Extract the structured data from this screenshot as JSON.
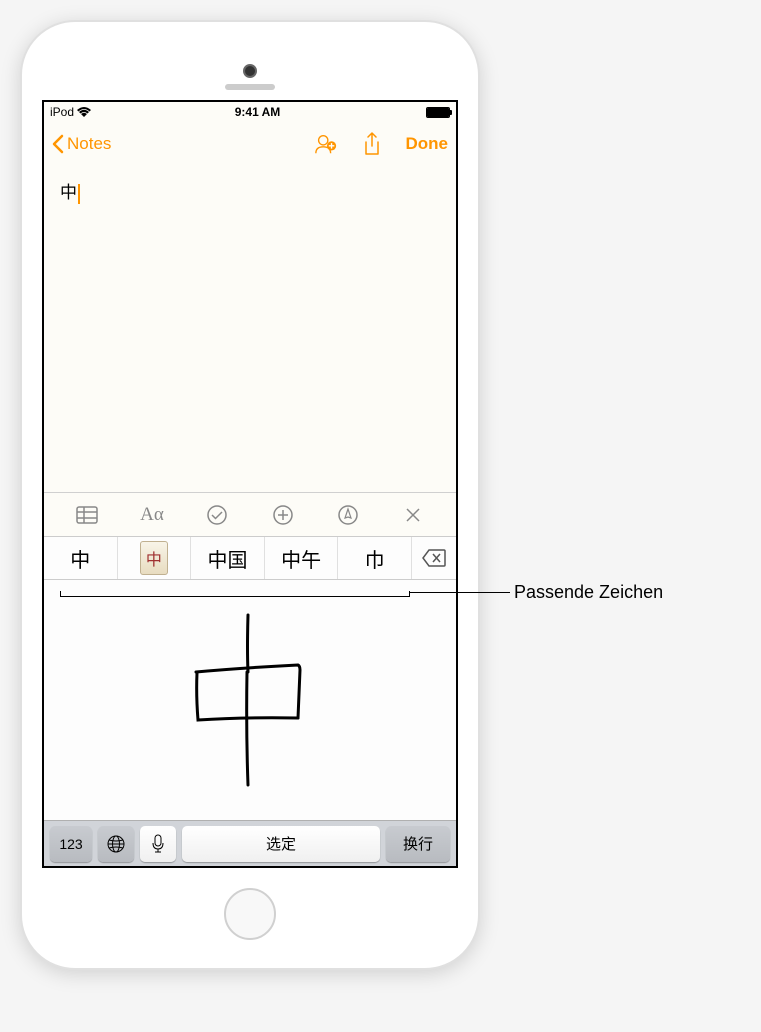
{
  "status_bar": {
    "carrier": "iPod",
    "time": "9:41 AM"
  },
  "nav": {
    "back_label": "Notes",
    "done_label": "Done"
  },
  "note": {
    "content": "中"
  },
  "candidates": {
    "items": [
      "中",
      "🀄",
      "中国",
      "中午",
      "巾"
    ],
    "emoji_char": "中"
  },
  "keyboard": {
    "numeric_label": "123",
    "select_label": "选定",
    "return_label": "换行"
  },
  "callout": {
    "label": "Passende Zeichen"
  }
}
